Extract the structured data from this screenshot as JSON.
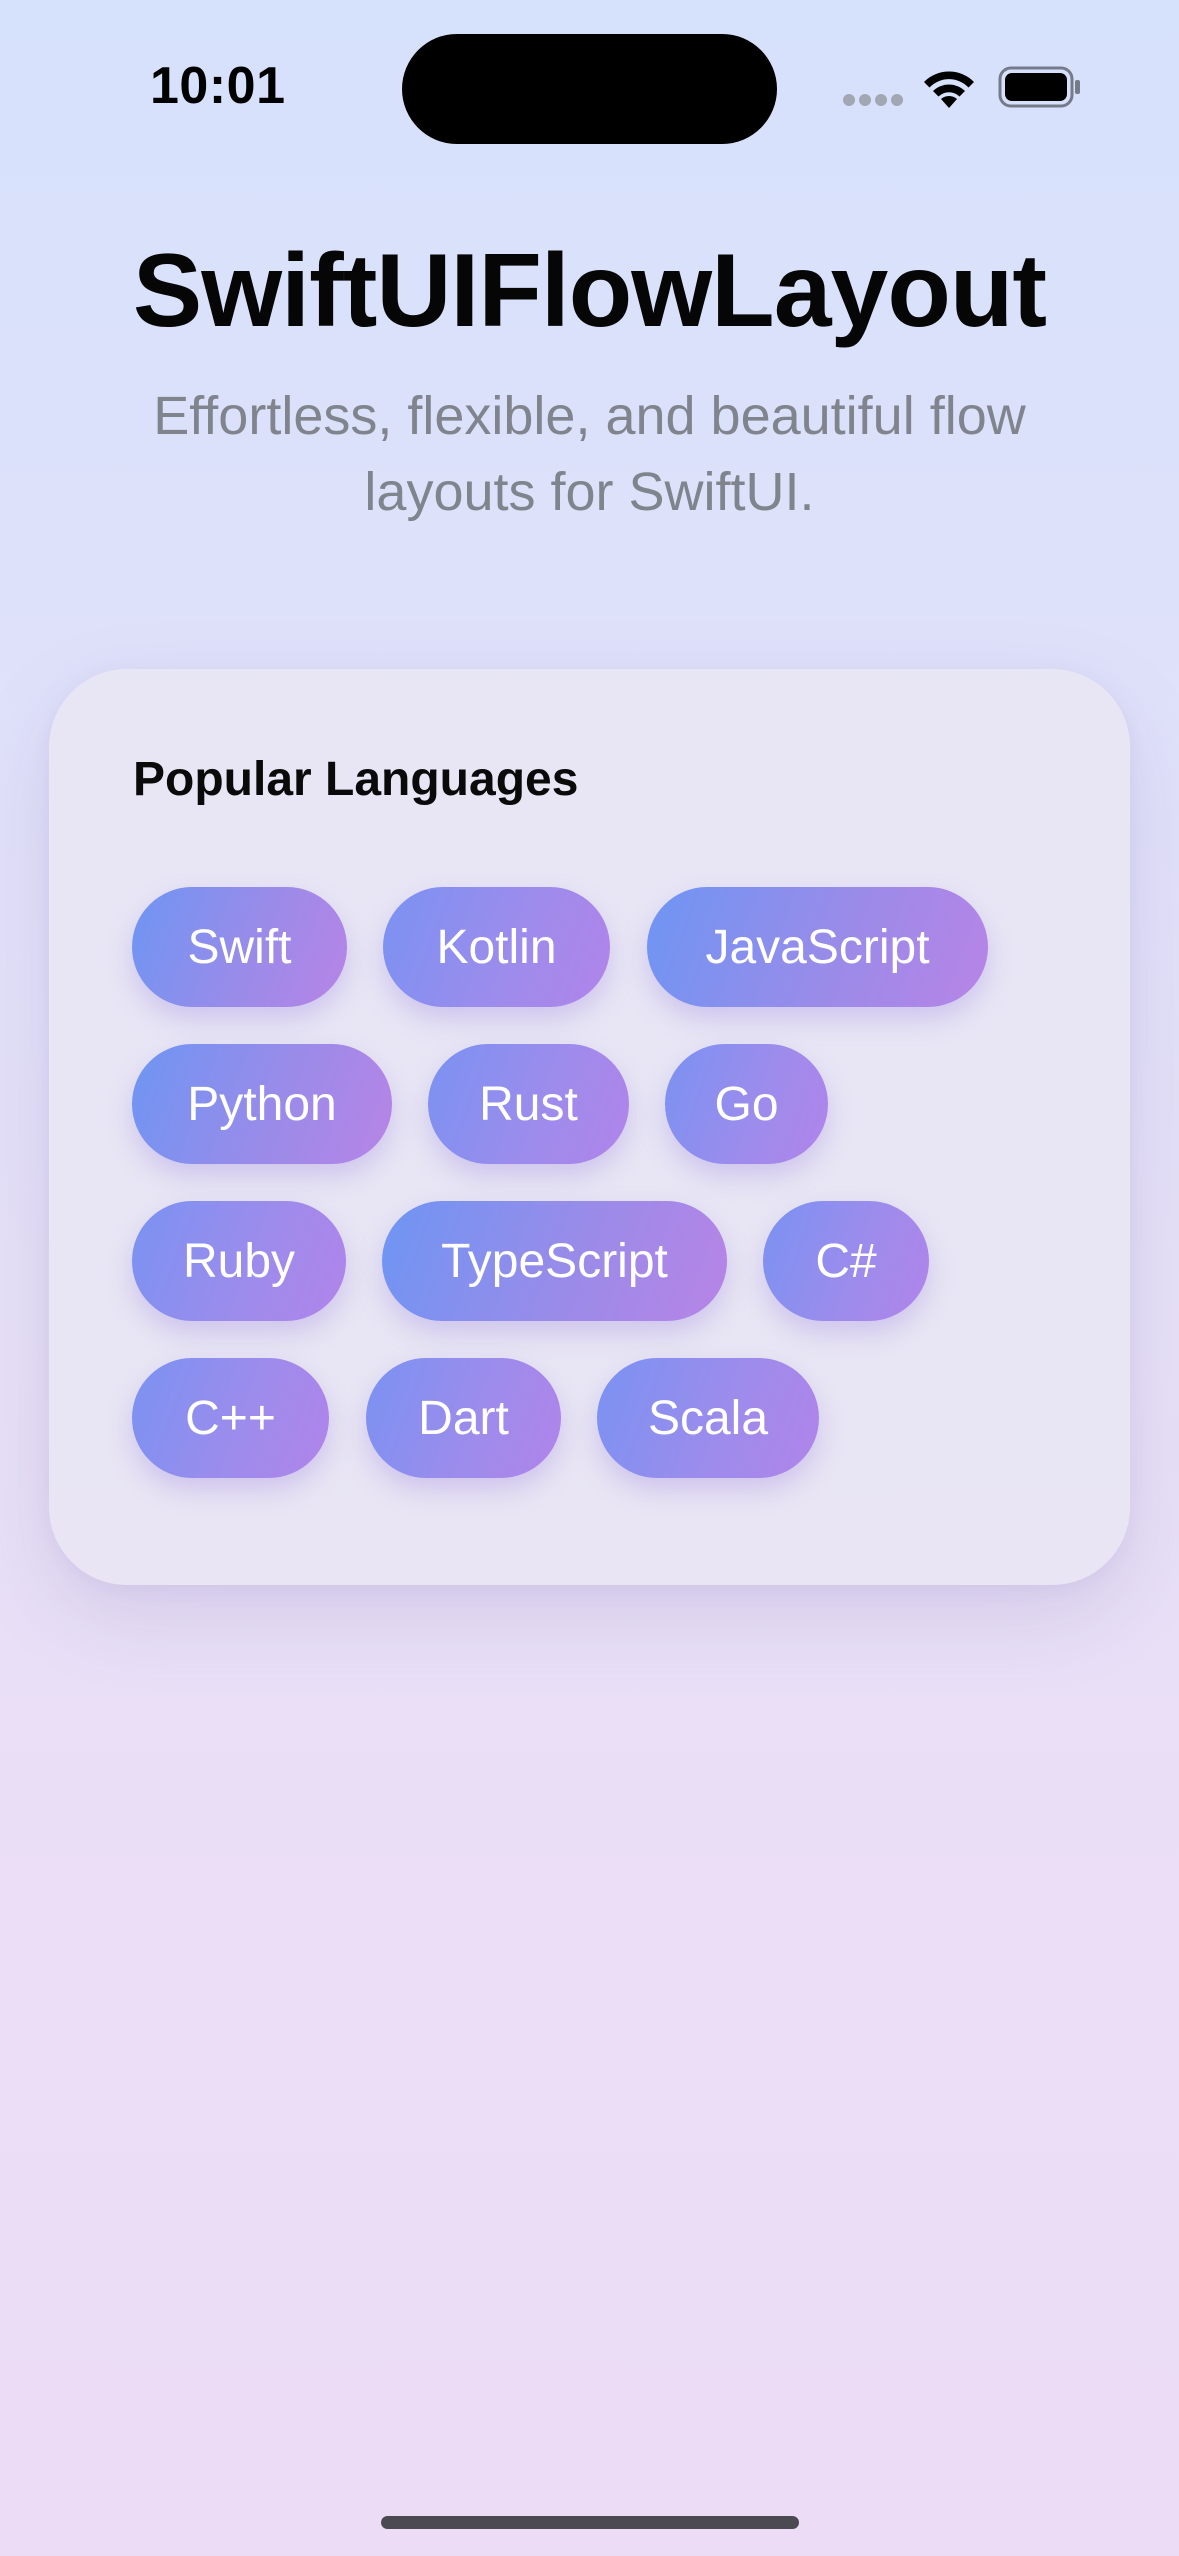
{
  "status_bar": {
    "time": "10:01",
    "icons": [
      "cellular-signal-icon",
      "wifi-icon",
      "battery-icon"
    ]
  },
  "header": {
    "title": "SwiftUIFlowLayout",
    "subtitle_line1": "Effortless, flexible, and beautiful flow",
    "subtitle_line2": "layouts for SwiftUI."
  },
  "card": {
    "title": "Popular Languages",
    "tags": [
      "Swift",
      "Kotlin",
      "JavaScript",
      "Python",
      "Rust",
      "Go",
      "Ruby",
      "TypeScript",
      "C#",
      "C++",
      "Dart",
      "Scala"
    ]
  },
  "colors": {
    "tag_gradient_start": "#6e95f3",
    "tag_gradient_end": "#b784e6",
    "title": "#060606",
    "subtitle": "#80848c"
  }
}
